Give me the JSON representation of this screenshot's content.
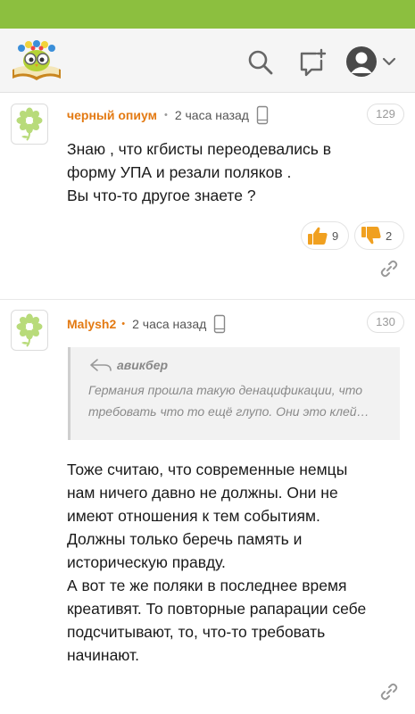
{
  "colors": {
    "status_bar": "#8cbf3f",
    "author": "#e37a13",
    "thumb": "#f0a020",
    "muted": "#9a9a9a"
  },
  "header": {
    "logo_icon": "owl-book-logo",
    "search_icon": "search-icon",
    "new_comment_icon": "new-comment-icon",
    "profile_icon": "user-avatar-icon",
    "menu_icon": "chevron-down-icon"
  },
  "comments": [
    {
      "avatar_icon": "flower-icon",
      "author": "черный опиум",
      "separator": "•",
      "time": "2 часа назад",
      "device_icon": "phone-icon",
      "number": "129",
      "text_lines": [
        "Знаю , что кгбисты переодевались в",
        "форму УПА и резали поляков .",
        "Вы что-то другое знаете ?"
      ],
      "likes": "9",
      "dislikes": "2",
      "link_icon": "link-icon"
    },
    {
      "avatar_icon": "flower-icon",
      "author": "Malysh2",
      "separator": "•",
      "time": "2 часа назад",
      "device_icon": "phone-icon",
      "number": "130",
      "quote": {
        "icon": "reply-arrow-icon",
        "author": "авикбер",
        "text": "Германия прошла такую денацификации, что требовать что то ещё глупо. Они это клей…"
      },
      "text_lines": [
        "Тоже считаю, что современные немцы",
        "нам ничего давно не должны. Они не",
        "имеют отношения к тем событиям.",
        "Должны только беречь память и",
        "историческую правду.",
        "А вот те же поляки в последнее время",
        "креативят. То повторные рапарации себе",
        "подсчитывают, то, что-то требовать",
        "начинают."
      ],
      "link_icon": "link-icon"
    }
  ]
}
